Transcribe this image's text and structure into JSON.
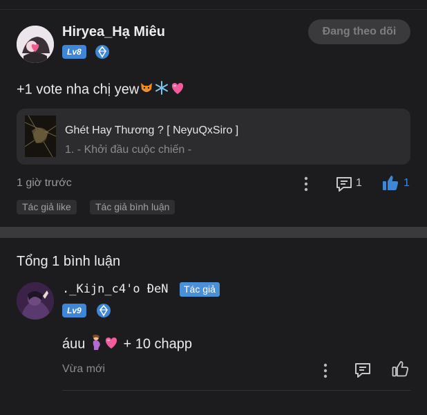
{
  "post": {
    "username": "Hiryea_Hạ Miêu",
    "level": "Lv8",
    "follow_label": "Đang theo dõi",
    "comment_text": "+1 vote nha chị yew",
    "comment_emojis": [
      "fox-emoji",
      "snowflake-emoji",
      "pink-heart-emoji"
    ],
    "story": {
      "title": "Ghét Hay Thương ? [ NeyuQxSiro ]",
      "chapter": "1. - Khởi đầu cuộc chiến -"
    },
    "time": "1 giờ trước",
    "reply_count": "1",
    "like_count": "1",
    "tags": [
      "Tác giả like",
      "Tác giả bình luận"
    ]
  },
  "replies_section": {
    "total_label": "Tổng 1 bình luận"
  },
  "reply": {
    "username": "._Kijn_c4'o ĐeN",
    "author_badge": "Tác giả",
    "level": "Lv9",
    "text_before": "áuu",
    "emojis": [
      "pregnant-woman-emoji",
      "pink-heart-emoji"
    ],
    "text_after": "+ 10 chapp",
    "time": "Vừa mới"
  },
  "colors": {
    "background": "#1c1c1e",
    "card": "#2c2c2e",
    "accent": "#3f87d6",
    "muted_text": "#8c8c90"
  }
}
